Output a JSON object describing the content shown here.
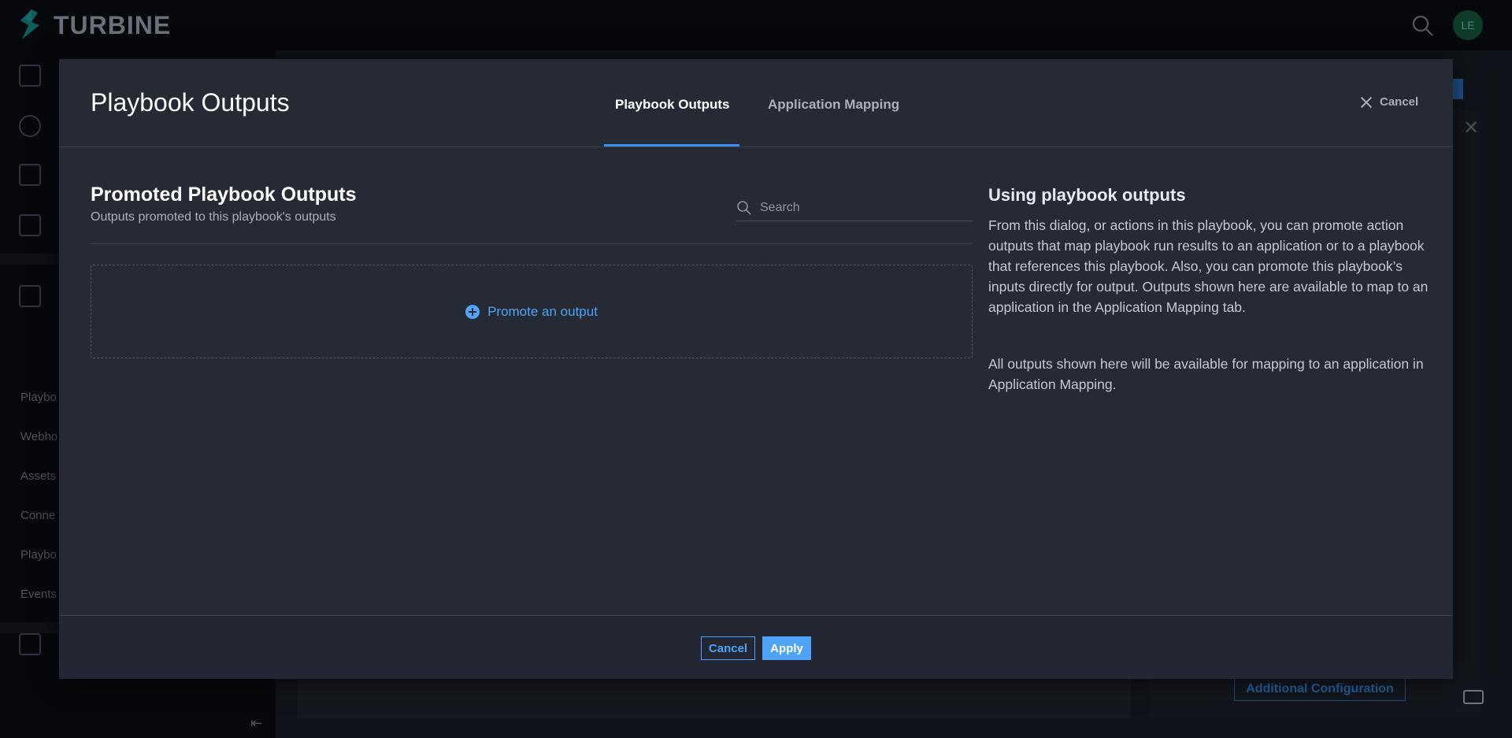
{
  "app": {
    "brand": "TURBINE",
    "avatar_initials": "LE",
    "additional_config_label": "Additional Configuration",
    "sidebar_partial": [
      "Playbo",
      "Webho",
      "Assets",
      "Conne",
      "Playbo",
      "Events"
    ]
  },
  "modal": {
    "title": "Playbook Outputs",
    "tabs": [
      {
        "label": "Playbook Outputs",
        "active": true
      },
      {
        "label": "Application Mapping",
        "active": false
      }
    ],
    "header_cancel": "Cancel",
    "section": {
      "title": "Promoted Playbook Outputs",
      "subtitle": "Outputs promoted to this playbook's outputs"
    },
    "search": {
      "placeholder": "Search",
      "value": ""
    },
    "promote_label": "Promote an output",
    "help": {
      "title": "Using playbook outputs",
      "paragraph1": "From this dialog, or actions in this playbook, you can promote action outputs that map playbook run results to an application or to a playbook that references this playbook. Also, you can promote this playbook’s inputs directly for output. Outputs shown here are available to map to an application in the Application Mapping tab.",
      "paragraph2": "All outputs shown here will be available for mapping to an application in Application Mapping."
    },
    "footer": {
      "cancel": "Cancel",
      "apply": "Apply"
    }
  },
  "colors": {
    "accent": "#4fa3f7",
    "modal_bg": "#252a35",
    "page_bg": "#0b0d11"
  }
}
